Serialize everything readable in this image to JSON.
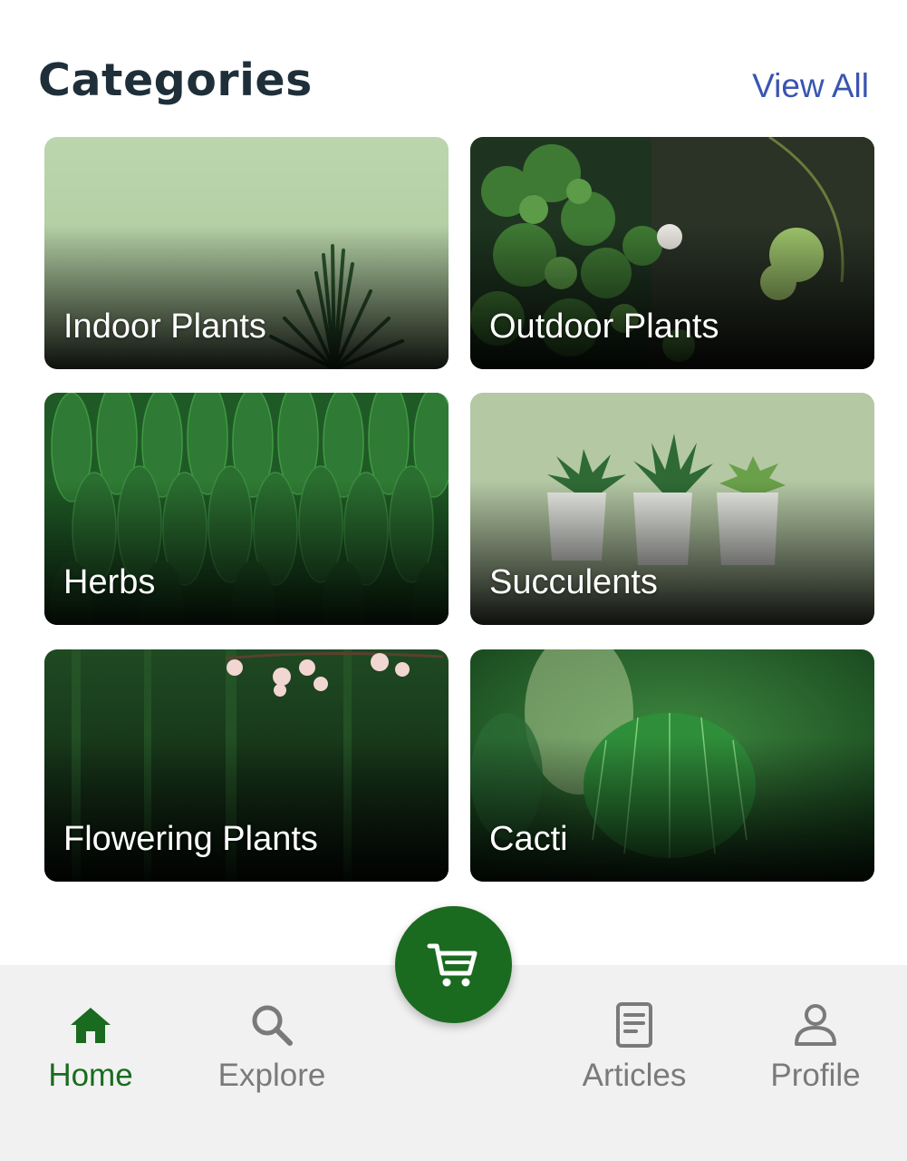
{
  "header": {
    "title": "Categories",
    "view_all_label": "View All"
  },
  "categories": [
    {
      "label": "Indoor Plants",
      "image": "indoor-plant-photo"
    },
    {
      "label": "Outdoor Plants",
      "image": "outdoor-plants-photo"
    },
    {
      "label": "Herbs",
      "image": "herb-leaves-photo"
    },
    {
      "label": "Succulents",
      "image": "succulents-pots-photo"
    },
    {
      "label": "Flowering Plants",
      "image": "flowering-branch-photo"
    },
    {
      "label": "Cacti",
      "image": "cactus-photo"
    }
  ],
  "cart_button": {
    "icon": "cart-icon",
    "color": "#1a6b1f"
  },
  "bottom_nav": {
    "items": [
      {
        "label": "Home",
        "icon": "home-icon",
        "active": true
      },
      {
        "label": "Explore",
        "icon": "search-icon",
        "active": false
      },
      {
        "label": "Articles",
        "icon": "document-icon",
        "active": false
      },
      {
        "label": "Profile",
        "icon": "user-icon",
        "active": false
      }
    ],
    "active_color": "#1a6b1f",
    "inactive_color": "#7a7a7a"
  }
}
